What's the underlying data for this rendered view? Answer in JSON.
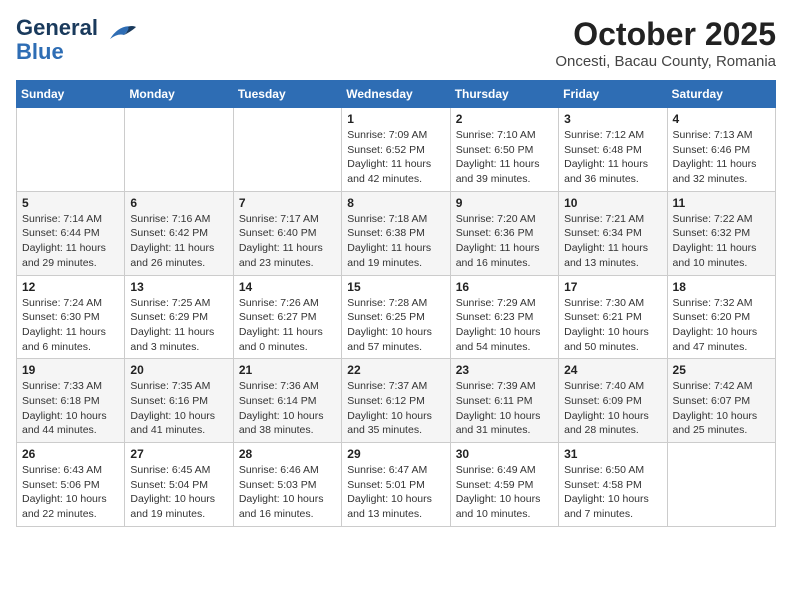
{
  "header": {
    "logo_line1": "General",
    "logo_line2": "Blue",
    "month": "October 2025",
    "location": "Oncesti, Bacau County, Romania"
  },
  "weekdays": [
    "Sunday",
    "Monday",
    "Tuesday",
    "Wednesday",
    "Thursday",
    "Friday",
    "Saturday"
  ],
  "weeks": [
    [
      {
        "day": "",
        "info": ""
      },
      {
        "day": "",
        "info": ""
      },
      {
        "day": "",
        "info": ""
      },
      {
        "day": "1",
        "info": "Sunrise: 7:09 AM\nSunset: 6:52 PM\nDaylight: 11 hours\nand 42 minutes."
      },
      {
        "day": "2",
        "info": "Sunrise: 7:10 AM\nSunset: 6:50 PM\nDaylight: 11 hours\nand 39 minutes."
      },
      {
        "day": "3",
        "info": "Sunrise: 7:12 AM\nSunset: 6:48 PM\nDaylight: 11 hours\nand 36 minutes."
      },
      {
        "day": "4",
        "info": "Sunrise: 7:13 AM\nSunset: 6:46 PM\nDaylight: 11 hours\nand 32 minutes."
      }
    ],
    [
      {
        "day": "5",
        "info": "Sunrise: 7:14 AM\nSunset: 6:44 PM\nDaylight: 11 hours\nand 29 minutes."
      },
      {
        "day": "6",
        "info": "Sunrise: 7:16 AM\nSunset: 6:42 PM\nDaylight: 11 hours\nand 26 minutes."
      },
      {
        "day": "7",
        "info": "Sunrise: 7:17 AM\nSunset: 6:40 PM\nDaylight: 11 hours\nand 23 minutes."
      },
      {
        "day": "8",
        "info": "Sunrise: 7:18 AM\nSunset: 6:38 PM\nDaylight: 11 hours\nand 19 minutes."
      },
      {
        "day": "9",
        "info": "Sunrise: 7:20 AM\nSunset: 6:36 PM\nDaylight: 11 hours\nand 16 minutes."
      },
      {
        "day": "10",
        "info": "Sunrise: 7:21 AM\nSunset: 6:34 PM\nDaylight: 11 hours\nand 13 minutes."
      },
      {
        "day": "11",
        "info": "Sunrise: 7:22 AM\nSunset: 6:32 PM\nDaylight: 11 hours\nand 10 minutes."
      }
    ],
    [
      {
        "day": "12",
        "info": "Sunrise: 7:24 AM\nSunset: 6:30 PM\nDaylight: 11 hours\nand 6 minutes."
      },
      {
        "day": "13",
        "info": "Sunrise: 7:25 AM\nSunset: 6:29 PM\nDaylight: 11 hours\nand 3 minutes."
      },
      {
        "day": "14",
        "info": "Sunrise: 7:26 AM\nSunset: 6:27 PM\nDaylight: 11 hours\nand 0 minutes."
      },
      {
        "day": "15",
        "info": "Sunrise: 7:28 AM\nSunset: 6:25 PM\nDaylight: 10 hours\nand 57 minutes."
      },
      {
        "day": "16",
        "info": "Sunrise: 7:29 AM\nSunset: 6:23 PM\nDaylight: 10 hours\nand 54 minutes."
      },
      {
        "day": "17",
        "info": "Sunrise: 7:30 AM\nSunset: 6:21 PM\nDaylight: 10 hours\nand 50 minutes."
      },
      {
        "day": "18",
        "info": "Sunrise: 7:32 AM\nSunset: 6:20 PM\nDaylight: 10 hours\nand 47 minutes."
      }
    ],
    [
      {
        "day": "19",
        "info": "Sunrise: 7:33 AM\nSunset: 6:18 PM\nDaylight: 10 hours\nand 44 minutes."
      },
      {
        "day": "20",
        "info": "Sunrise: 7:35 AM\nSunset: 6:16 PM\nDaylight: 10 hours\nand 41 minutes."
      },
      {
        "day": "21",
        "info": "Sunrise: 7:36 AM\nSunset: 6:14 PM\nDaylight: 10 hours\nand 38 minutes."
      },
      {
        "day": "22",
        "info": "Sunrise: 7:37 AM\nSunset: 6:12 PM\nDaylight: 10 hours\nand 35 minutes."
      },
      {
        "day": "23",
        "info": "Sunrise: 7:39 AM\nSunset: 6:11 PM\nDaylight: 10 hours\nand 31 minutes."
      },
      {
        "day": "24",
        "info": "Sunrise: 7:40 AM\nSunset: 6:09 PM\nDaylight: 10 hours\nand 28 minutes."
      },
      {
        "day": "25",
        "info": "Sunrise: 7:42 AM\nSunset: 6:07 PM\nDaylight: 10 hours\nand 25 minutes."
      }
    ],
    [
      {
        "day": "26",
        "info": "Sunrise: 6:43 AM\nSunset: 5:06 PM\nDaylight: 10 hours\nand 22 minutes."
      },
      {
        "day": "27",
        "info": "Sunrise: 6:45 AM\nSunset: 5:04 PM\nDaylight: 10 hours\nand 19 minutes."
      },
      {
        "day": "28",
        "info": "Sunrise: 6:46 AM\nSunset: 5:03 PM\nDaylight: 10 hours\nand 16 minutes."
      },
      {
        "day": "29",
        "info": "Sunrise: 6:47 AM\nSunset: 5:01 PM\nDaylight: 10 hours\nand 13 minutes."
      },
      {
        "day": "30",
        "info": "Sunrise: 6:49 AM\nSunset: 4:59 PM\nDaylight: 10 hours\nand 10 minutes."
      },
      {
        "day": "31",
        "info": "Sunrise: 6:50 AM\nSunset: 4:58 PM\nDaylight: 10 hours\nand 7 minutes."
      },
      {
        "day": "",
        "info": ""
      }
    ]
  ]
}
